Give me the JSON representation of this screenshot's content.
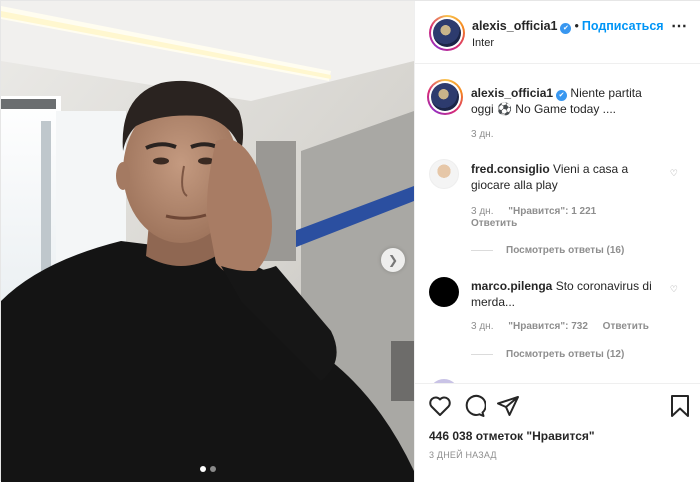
{
  "post": {
    "username": "alexis_officia1",
    "separator": "•",
    "follow_label": "Подписаться",
    "location": "Inter",
    "more_icon": "⋯",
    "verified_glyph": "✔",
    "caption": {
      "username": "alexis_officia1",
      "text": "Niente partita oggi ⚽ No Game today ....",
      "time": "3 дн."
    },
    "comments": [
      {
        "username": "fred.consiglio",
        "text": "Vieni a casa a giocare alla play",
        "time": "3 дн.",
        "likes": "\"Нравится\": 1 221",
        "reply_label": "Ответить",
        "view_replies": "Посмотреть ответы (16)"
      },
      {
        "username": "marco.pilenga",
        "text": "Sto coronavirus di merda...",
        "time": "3 дн.",
        "likes": "\"Нравится\": 732",
        "reply_label": "Ответить",
        "view_replies": "Посмотреть ответы (12)"
      }
    ],
    "likes_text": "446 038 отметок \"Нравится\"",
    "posted_ago": "3 ДНЕЙ НАЗАД",
    "carousel_arrow": "❯",
    "icons": [
      "heart-icon",
      "comment-icon",
      "share-icon",
      "bookmark-icon"
    ],
    "colors": {
      "accent": "#0095f6",
      "verified": "#3897f0",
      "muted": "#8e8e8e"
    }
  }
}
